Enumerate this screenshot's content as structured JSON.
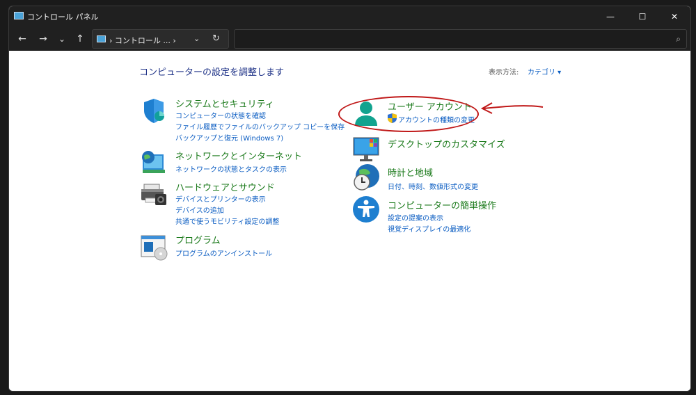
{
  "window": {
    "title": "コントロール パネル",
    "minimize_glyph": "—",
    "maximize_glyph": "☐",
    "close_glyph": "✕"
  },
  "toolbar": {
    "back_glyph": "←",
    "forward_glyph": "→",
    "history_glyph": "⌄",
    "up_glyph": "↑",
    "address_text": "› コントロール ... ›",
    "address_dropdown_glyph": "⌄",
    "refresh_glyph": "↻",
    "search_value": "",
    "search_glyph": "⌕"
  },
  "main": {
    "heading": "コンピューターの設定を調整します",
    "view_by_label": "表示方法:",
    "view_by_value": "カテゴリ ▾"
  },
  "categories": {
    "system": {
      "title": "システムとセキュリティ",
      "icon": "shield-icon",
      "links": [
        "コンピューターの状態を確認",
        "ファイル履歴でファイルのバックアップ コピーを保存",
        "バックアップと復元 (Windows 7)"
      ]
    },
    "network": {
      "title": "ネットワークとインターネット",
      "icon": "network-globe-icon",
      "links": [
        "ネットワークの状態とタスクの表示"
      ]
    },
    "hardware": {
      "title": "ハードウェアとサウンド",
      "icon": "printer-icon",
      "links": [
        "デバイスとプリンターの表示",
        "デバイスの追加",
        "共通で使うモビリティ設定の調整"
      ]
    },
    "programs": {
      "title": "プログラム",
      "icon": "programs-icon",
      "links": [
        "プログラムのアンインストール"
      ]
    },
    "users": {
      "title": "ユーザー アカウント",
      "icon": "user-account-icon",
      "links": [
        "アカウントの種類の変更"
      ],
      "link_icon": "uac-shield-icon"
    },
    "appearance": {
      "title": "デスクトップのカスタマイズ",
      "icon": "desktop-monitor-icon",
      "links": []
    },
    "clock": {
      "title": "時計と地域",
      "icon": "clock-globe-icon",
      "links": [
        "日付、時刻、数値形式の変更"
      ]
    },
    "ease": {
      "title": "コンピューターの簡単操作",
      "icon": "accessibility-icon",
      "links": [
        "設定の提案の表示",
        "視覚ディスプレイの最適化"
      ]
    }
  },
  "annotation": {
    "color": "#c01818"
  },
  "colors": {
    "category_title": "#1b7a1b",
    "link": "#0a5cc2",
    "heading": "#1e3287"
  }
}
